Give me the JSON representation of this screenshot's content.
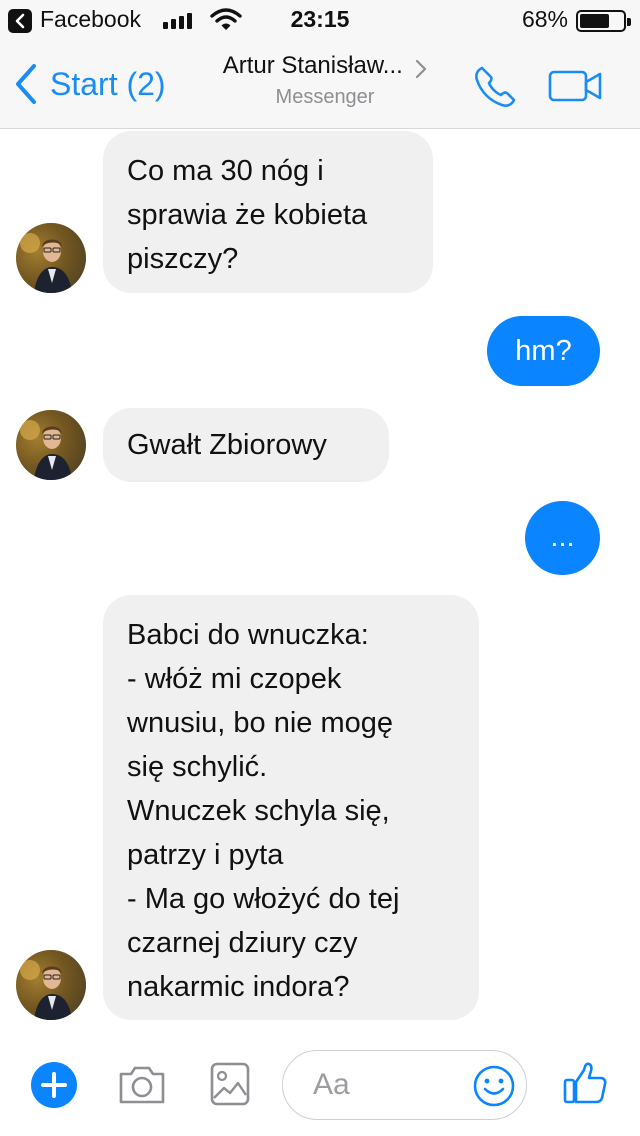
{
  "status_bar": {
    "back_app": "Facebook",
    "time": "23:15",
    "battery_percent": "68%",
    "battery_level": 0.68,
    "signal_bars": 4
  },
  "nav": {
    "back_label": "Start (2)",
    "contact_name": "Artur Stanisław...",
    "subtitle": "Messenger",
    "accent_color": "#1a8cf4"
  },
  "messages": [
    {
      "from": "them",
      "lines": [
        "Co ma 30 nóg i",
        "sprawia że kobieta",
        "piszczy?"
      ]
    },
    {
      "from": "me",
      "text": "hm?"
    },
    {
      "from": "them",
      "lines": [
        "Gwałt Zbiorowy"
      ]
    },
    {
      "from": "me",
      "text": "..."
    },
    {
      "from": "them",
      "lines": [
        "Babci do wnuczka:",
        "- włóż mi czopek",
        "wnusiu, bo nie mogę",
        "się schylić.",
        "Wnuczek schyla się,",
        "patrzy i pyta",
        "- Ma go włożyć do tej",
        "czarnej dziury czy",
        "nakarmic indora?"
      ]
    }
  ],
  "composer": {
    "placeholder": "Aa"
  },
  "colors": {
    "outgoing_bubble": "#0a84ff",
    "incoming_bubble": "#f1f0f0"
  }
}
